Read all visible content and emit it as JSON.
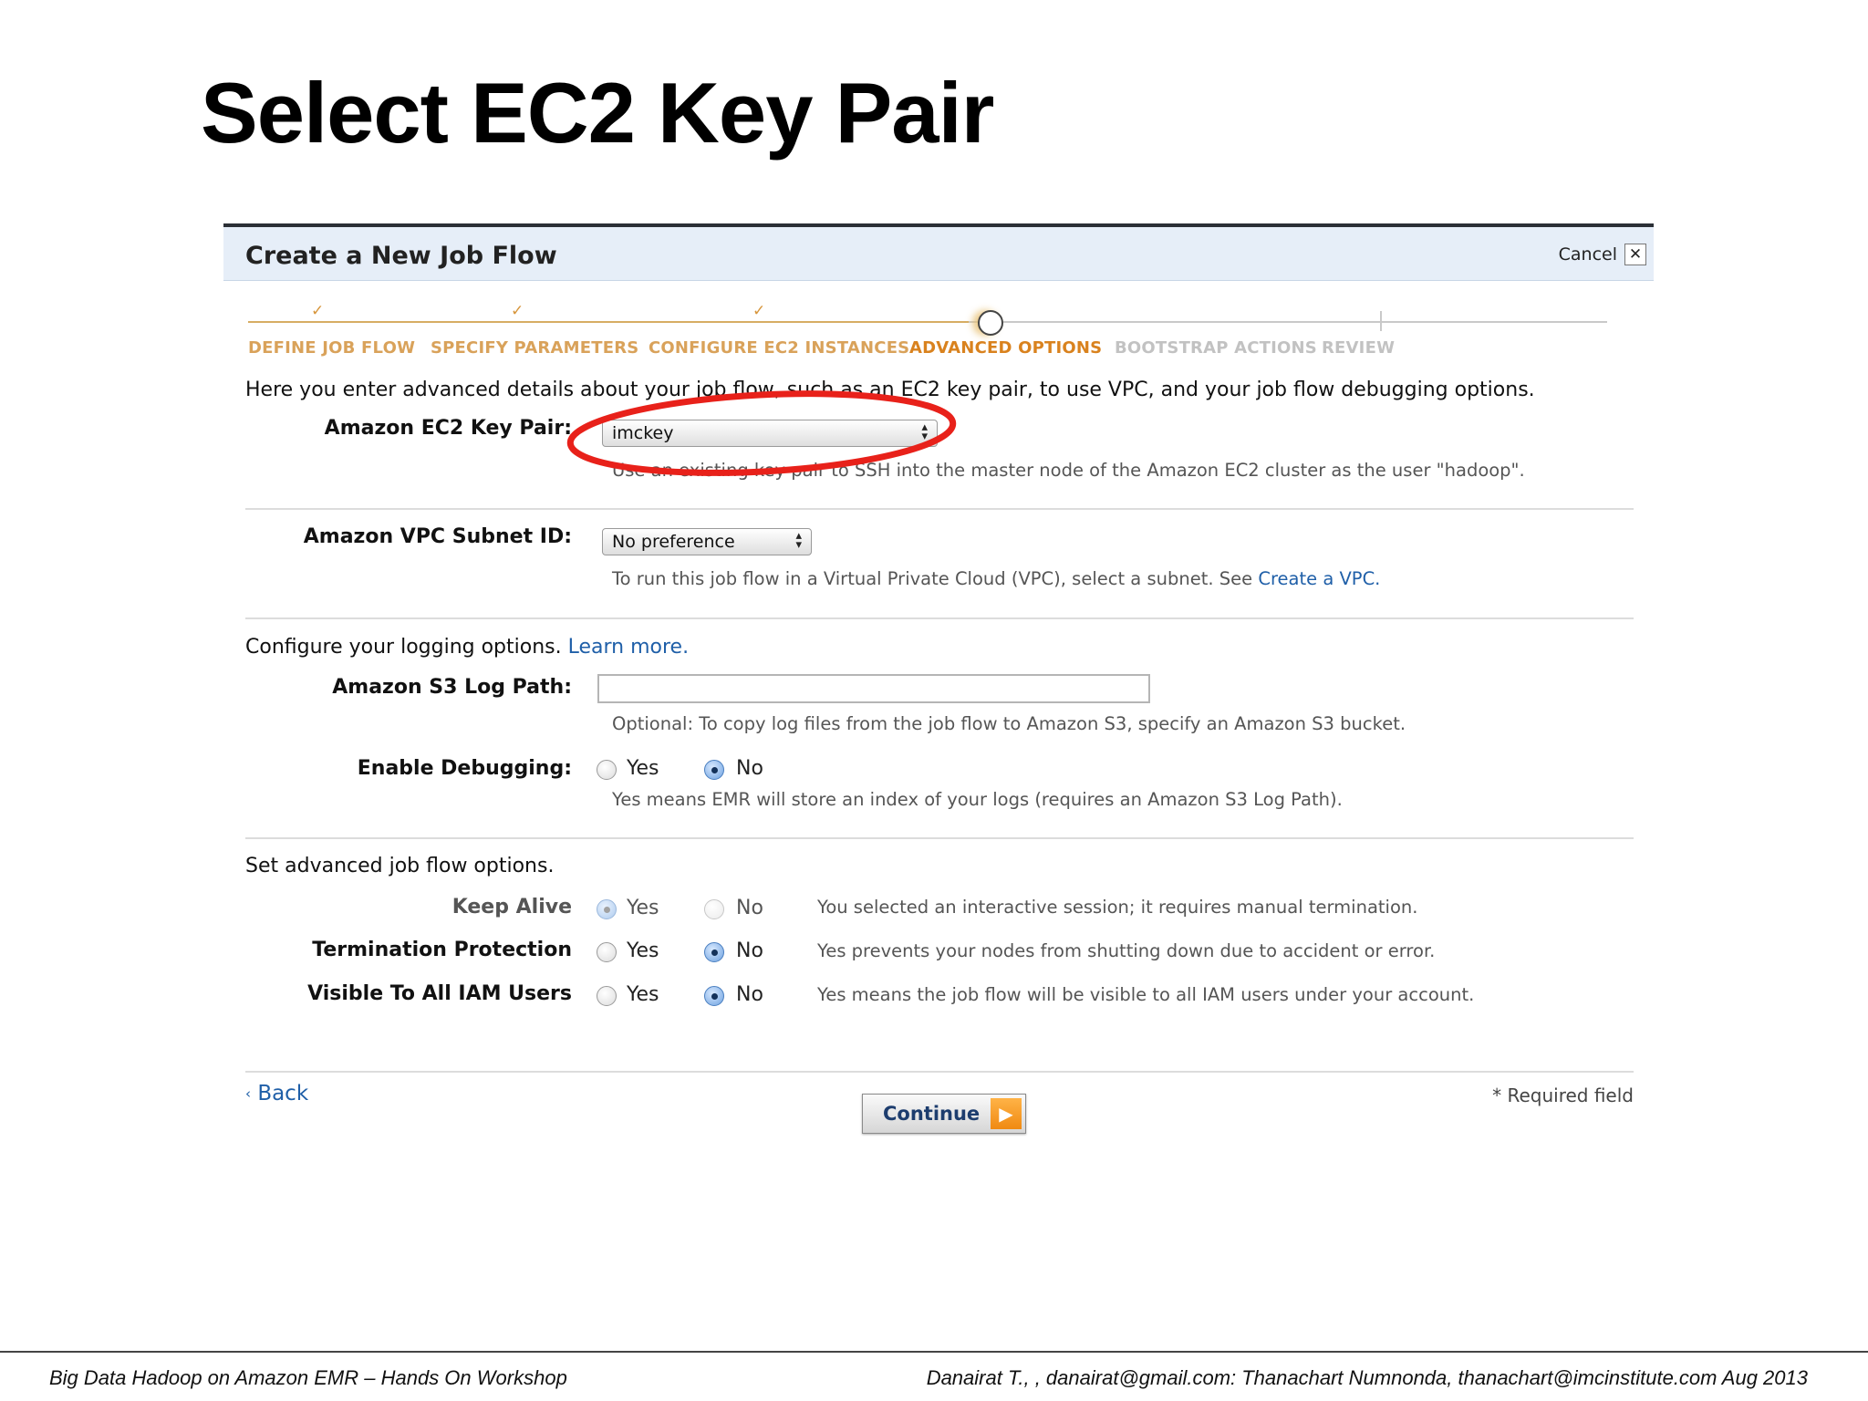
{
  "slide": {
    "title": "Select EC2 Key Pair",
    "footer_left": "Big Data Hadoop on Amazon EMR – Hands On Workshop",
    "footer_right": "Danairat T., , danairat@gmail.com:  Thanachart Numnonda,  thanachart@imcinstitute.com   Aug 2013"
  },
  "dialog": {
    "title": "Create a New Job Flow",
    "cancel_label": "Cancel",
    "steps": [
      {
        "label": "DEFINE JOB FLOW",
        "state": "done"
      },
      {
        "label": "SPECIFY PARAMETERS",
        "state": "done"
      },
      {
        "label": "CONFIGURE EC2 INSTANCES",
        "state": "done"
      },
      {
        "label": "ADVANCED OPTIONS",
        "state": "active"
      },
      {
        "label": "BOOTSTRAP ACTIONS",
        "state": "todo"
      },
      {
        "label": "REVIEW",
        "state": "todo"
      }
    ],
    "intro": "Here you enter advanced details about your job flow, such as an EC2 key pair, to use VPC, and your job flow debugging options.",
    "key_pair": {
      "label": "Amazon EC2 Key Pair:",
      "value": "imckey",
      "hint": "Use an existing key pair to SSH into the master node of the Amazon EC2 cluster as the user \"hadoop\"."
    },
    "vpc": {
      "label": "Amazon VPC Subnet ID:",
      "value": "No preference",
      "hint": "To run this job flow in a Virtual Private Cloud (VPC), select a subnet. See",
      "hint_link": "Create a VPC."
    },
    "logging": {
      "intro": "Configure your logging options.",
      "intro_link": "Learn more.",
      "log_path_label": "Amazon S3 Log Path:",
      "log_path_value": "",
      "log_path_hint": "Optional: To copy log files from the job flow to Amazon S3, specify an Amazon S3 bucket.",
      "debug_label": "Enable Debugging:",
      "debug_value": "No",
      "debug_hint": "Yes means EMR will store an index of your logs (requires an Amazon S3 Log Path)."
    },
    "advanced": {
      "intro": "Set advanced job flow options.",
      "options": [
        {
          "label": "Keep Alive",
          "value": "Yes",
          "hint": "You selected an interactive session; it requires manual termination.",
          "disabled": true
        },
        {
          "label": "Termination Protection",
          "value": "No",
          "hint": "Yes prevents your nodes from shutting down due to accident or error.",
          "disabled": false
        },
        {
          "label": "Visible To All IAM Users",
          "value": "No",
          "hint": "Yes means the job flow will be visible to all IAM users under your account.",
          "disabled": false
        }
      ]
    },
    "yes_label": "Yes",
    "no_label": "No",
    "back_label": "Back",
    "continue_label": "Continue",
    "required_note": "* Required field"
  },
  "colors": {
    "header_bg": "#e6eef8",
    "link": "#1f5fa8",
    "step_done": "#d9a25a",
    "step_active": "#d9821e",
    "highlight_circle": "#e8211a"
  },
  "icons": {
    "cancel": "close-icon",
    "step_done": "check-icon",
    "step_current": "circle-icon",
    "back": "chevron-left-icon",
    "continue": "arrow-right-icon",
    "select": "up-down-arrows-icon"
  }
}
